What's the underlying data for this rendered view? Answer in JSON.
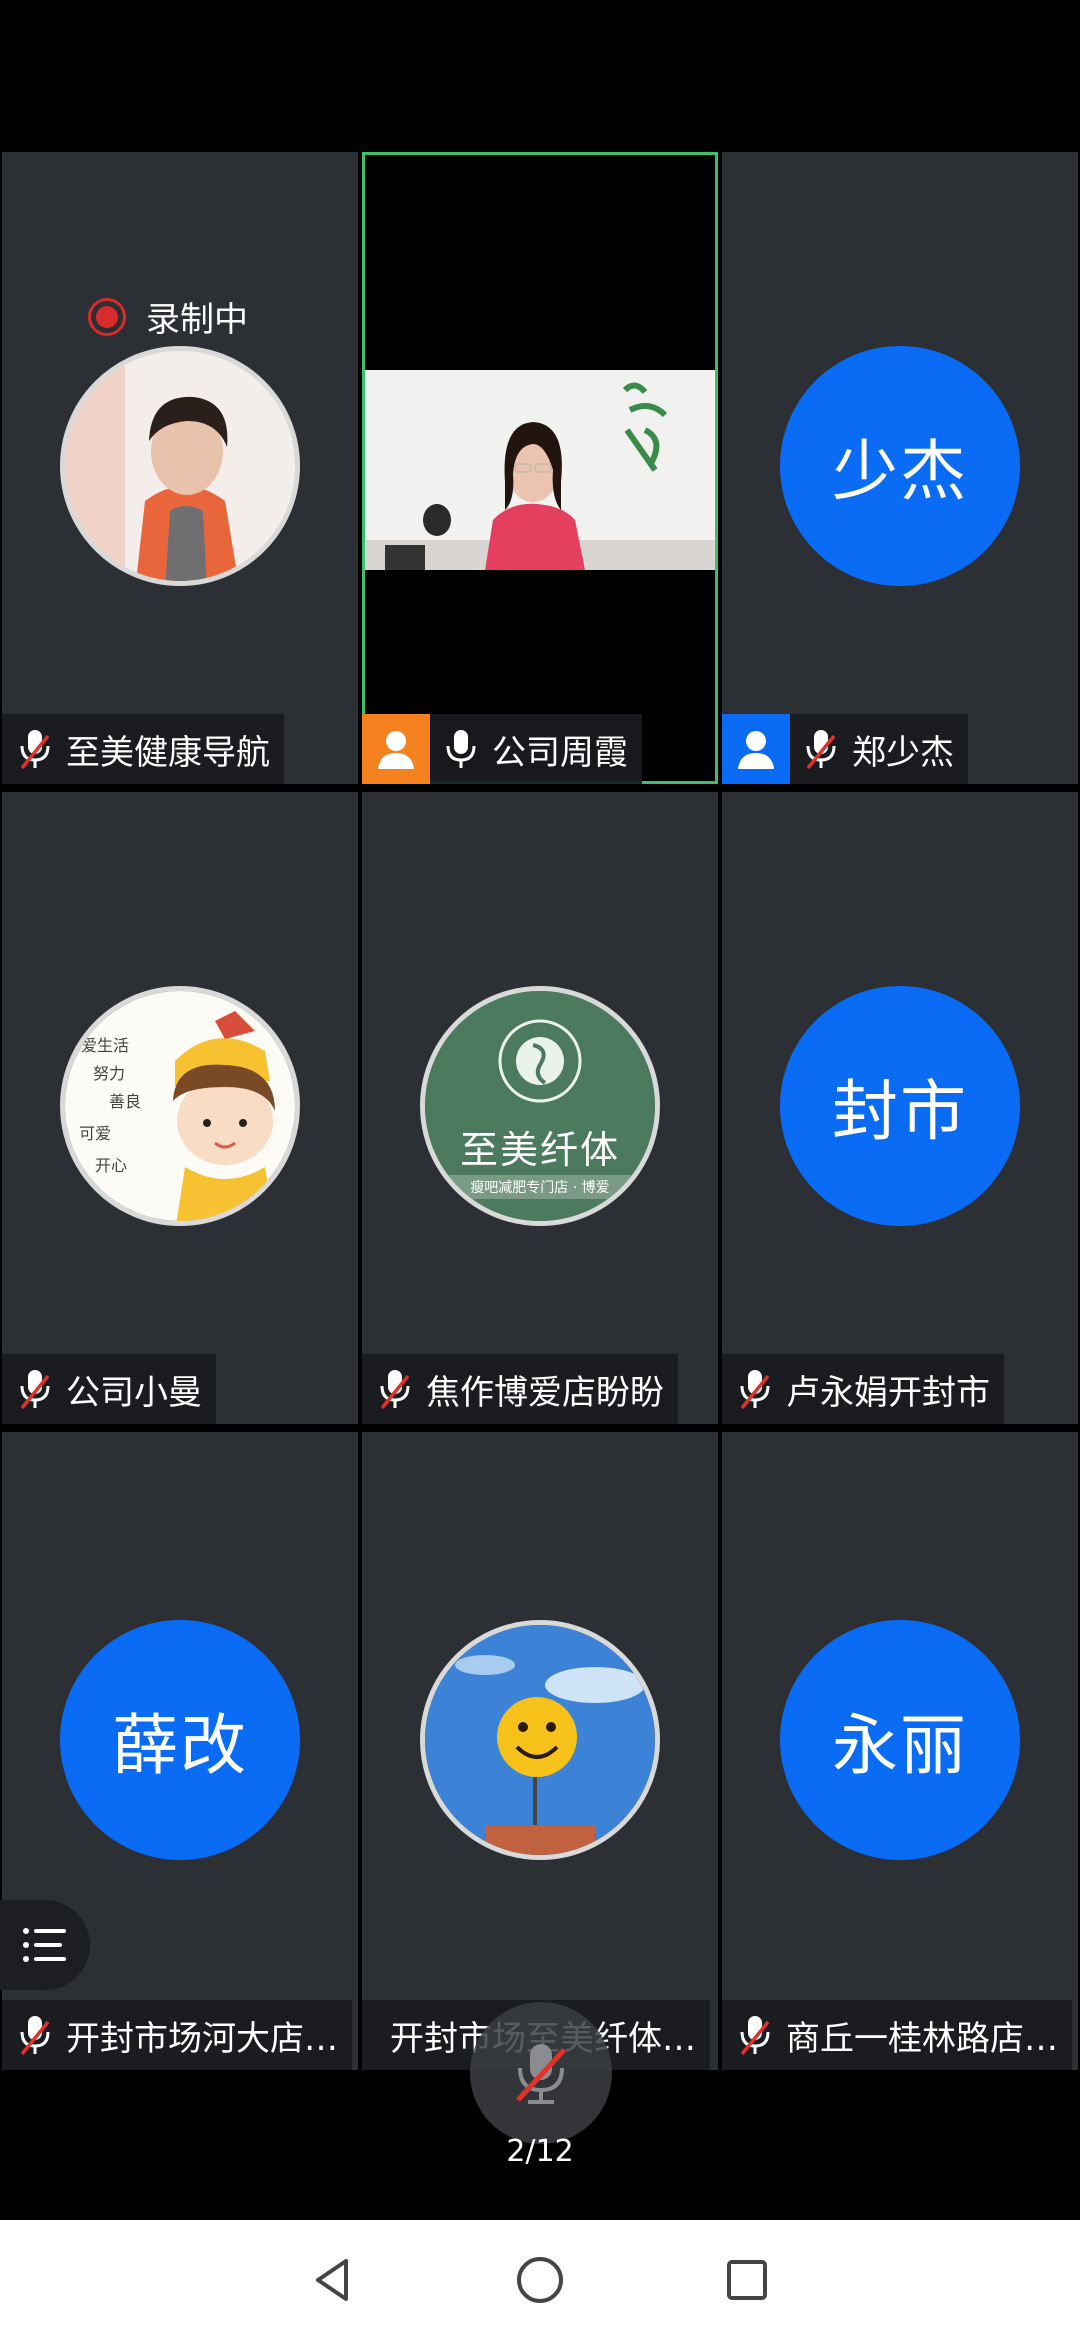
{
  "recording": {
    "label": "录制中"
  },
  "participants": [
    {
      "name": "至美健康导航",
      "avatar_type": "photo",
      "avatar_text": "",
      "mic": "muted",
      "host": false
    },
    {
      "name": "公司周霞",
      "avatar_type": "video",
      "avatar_text": "",
      "mic": "on",
      "host": true,
      "host_color": "#f5821f",
      "active": true
    },
    {
      "name": "郑少杰",
      "avatar_type": "text",
      "avatar_text": "少杰",
      "mic": "muted",
      "host": true,
      "host_color": "#0a6cf5"
    },
    {
      "name": "公司小曼",
      "avatar_type": "photo",
      "avatar_text": "",
      "mic": "muted",
      "host": false
    },
    {
      "name": "焦作博爱店盼盼",
      "avatar_type": "photo",
      "avatar_text": "至美纤体",
      "mic": "muted",
      "host": false
    },
    {
      "name": "卢永娟开封市",
      "avatar_type": "text",
      "avatar_text": "封市",
      "mic": "muted",
      "host": false
    },
    {
      "name": "",
      "avatar_type": "text",
      "avatar_text": "薛改",
      "mic": "none",
      "host": false
    },
    {
      "name": "",
      "avatar_type": "photo",
      "avatar_text": "",
      "mic": "none",
      "host": false
    },
    {
      "name": "",
      "avatar_type": "text",
      "avatar_text": "永丽",
      "mic": "none",
      "host": false
    }
  ],
  "footer_names": {
    "left": "开封市场河大店…",
    "middle": "开封市场至美纤体…",
    "right": "商丘一桂林路店…"
  },
  "logo_text": {
    "brand": "至美纤体",
    "sub": "瘦吧减肥专门店 · 博爱"
  },
  "pagination": {
    "label": "2/12"
  },
  "colors": {
    "tile_bg": "#2c2f33",
    "avatar_blue": "#0a6cf5",
    "active_border": "#3cbf6e",
    "muted_red": "#e0312b"
  }
}
